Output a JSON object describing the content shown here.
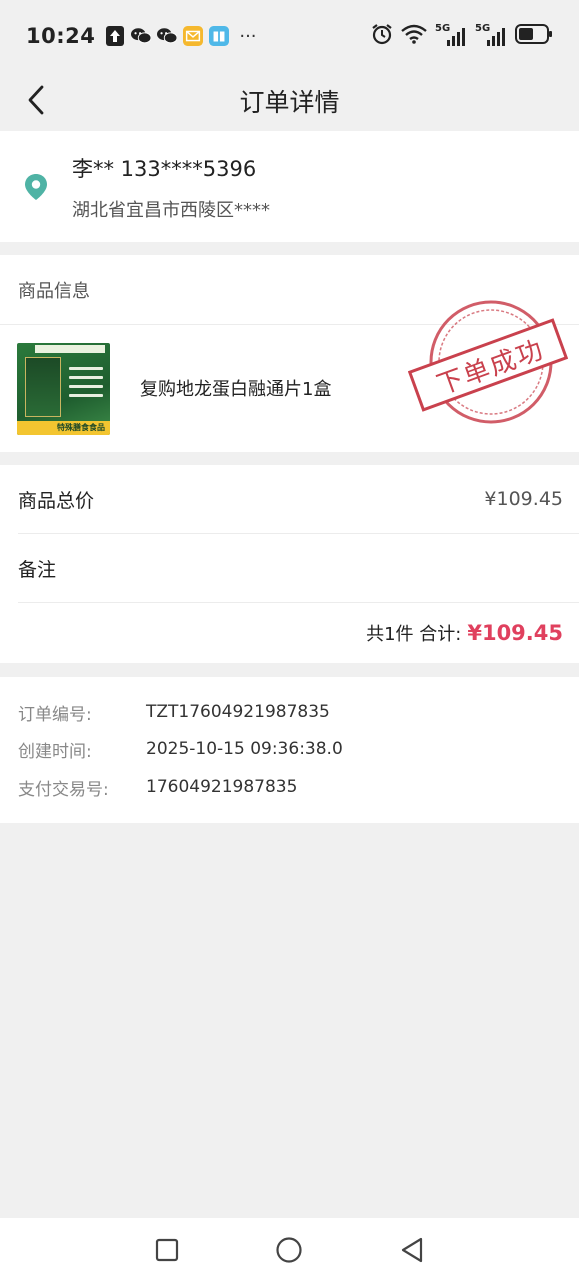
{
  "status_bar": {
    "time": "10:24",
    "network_1": "5G",
    "network_2": "5G",
    "dots": "···"
  },
  "nav": {
    "title": "订单详情"
  },
  "address": {
    "name_phone": "李** 133****5396",
    "address": "湖北省宜昌市西陵区****"
  },
  "product": {
    "section_title": "商品信息",
    "name": "复购地龙蛋白融通片1盒",
    "image_banner_text": "特殊膳食食品",
    "stamp_text": "下单成功"
  },
  "price": {
    "total_label": "商品总价",
    "total_value": "¥109.45",
    "remark_label": "备注",
    "count_text": "共1件 合计:",
    "sum_value": "¥109.45"
  },
  "order_info": {
    "order_no_label": "订单编号:",
    "order_no": "TZT17604921987835",
    "created_label": "创建时间:",
    "created": "2025-10-15 09:36:38.0",
    "pay_label": "支付交易号:",
    "pay_no": "17604921987835"
  },
  "colors": {
    "accent_red": "#e0405e",
    "location_teal": "#4fb3a5",
    "stamp_red": "#c9414d"
  }
}
